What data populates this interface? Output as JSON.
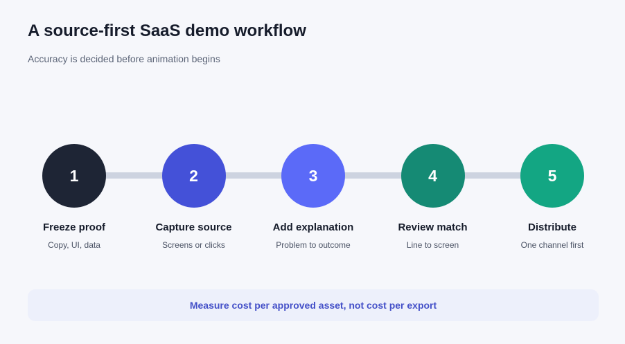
{
  "header": {
    "title": "A source-first SaaS demo workflow",
    "subtitle": "Accuracy is decided before animation begins"
  },
  "steps": [
    {
      "number": "1",
      "label": "Freeze proof",
      "caption": "Copy, UI, data",
      "color": "#1e2535"
    },
    {
      "number": "2",
      "label": "Capture source",
      "caption": "Screens or clicks",
      "color": "#4451d8"
    },
    {
      "number": "3",
      "label": "Add explanation",
      "caption": "Problem to outcome",
      "color": "#5b6af8"
    },
    {
      "number": "4",
      "label": "Review match",
      "caption": "Line to screen",
      "color": "#158a74"
    },
    {
      "number": "5",
      "label": "Distribute",
      "caption": "One channel first",
      "color": "#13a683"
    }
  ],
  "footer": {
    "message": "Measure cost per approved asset, not cost per export"
  },
  "colors": {
    "background": "#f6f7fb",
    "connector": "#cdd3e0",
    "banner_background": "#edf0fb",
    "banner_text": "#4450c8"
  }
}
